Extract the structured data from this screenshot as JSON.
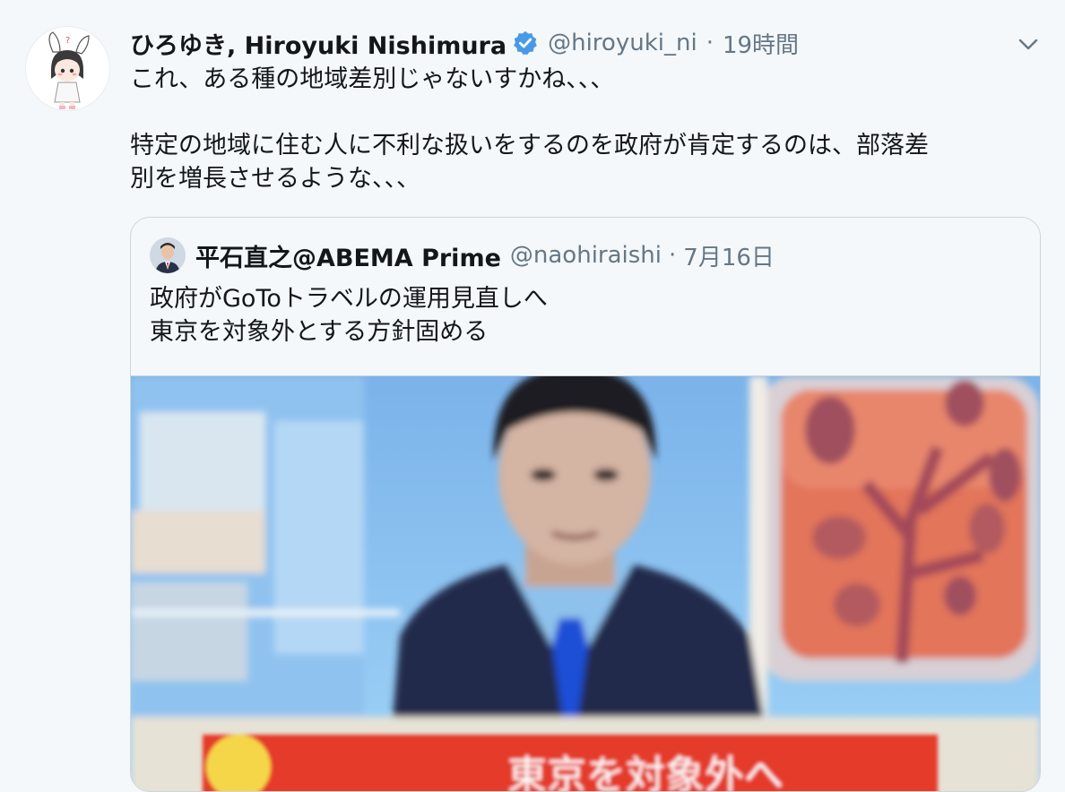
{
  "tweet": {
    "display_name": "ひろゆき, Hiroyuki Nishimura",
    "handle": "@hiroyuki_ni",
    "separator": "·",
    "time": "19時間",
    "text": "これ、ある種の地域差別じゃないすかね、、、\n\n特定の地域に住む人に不利な扱いをするのを政府が肯定するのは、部落差\n別を増長させるような、、、",
    "icons": {
      "avatar": "anime-girl-avatar",
      "verified": "verified-badge-icon",
      "menu": "chevron-down-icon"
    },
    "colors": {
      "verified": "#4a99e9",
      "secondary_text": "#657786",
      "background": "#f5f8fa",
      "border": "#ccd6dd"
    }
  },
  "quoted_tweet": {
    "display_name": "平石直之@ABEMA Prime",
    "handle": "@naohiraishi",
    "separator": "·",
    "time": "7月16日",
    "text": "政府がGoToトラベルの運用見直しへ\n東京を対象外とする方針固める",
    "media": {
      "description_icon": "tv-news-anchor-photo",
      "caption": "東京を対象外へ"
    }
  }
}
